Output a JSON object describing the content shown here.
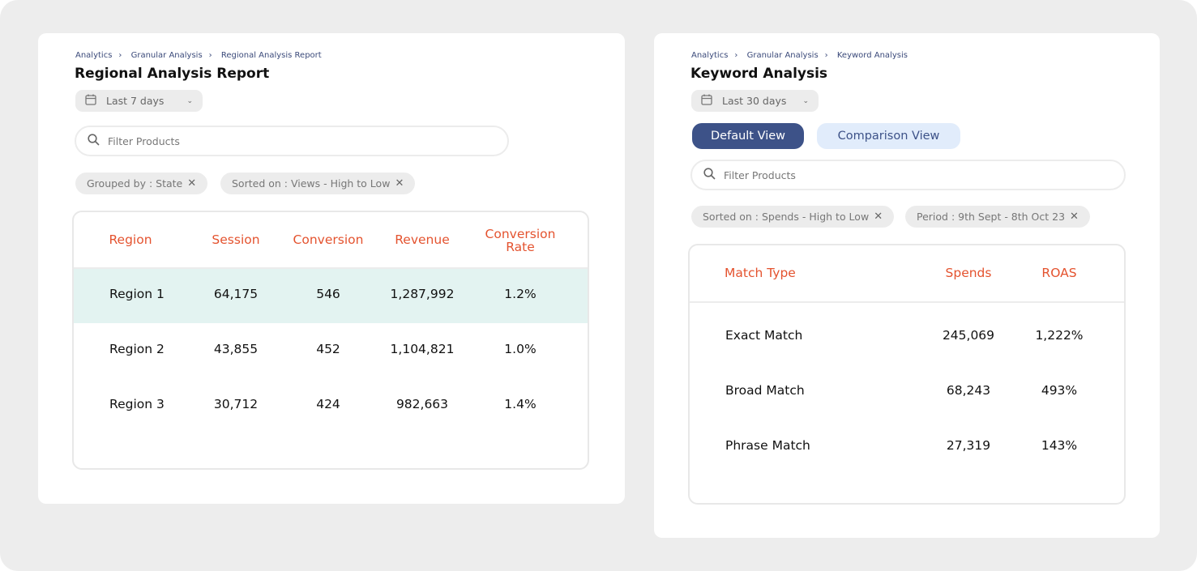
{
  "left": {
    "breadcrumb": [
      "Analytics",
      "Granular Analysis",
      "Regional Analysis Report"
    ],
    "title": "Regional Analysis Report",
    "date_range": "Last 7 days",
    "search_placeholder": "Filter Products",
    "chips": [
      "Grouped by : State",
      "Sorted on : Views - High to Low"
    ],
    "columns": [
      "Region",
      "Session",
      "Conversion",
      "Revenue",
      "Conversion Rate"
    ],
    "rows": [
      [
        "Region 1",
        "64,175",
        "546",
        "1,287,992",
        "1.2%"
      ],
      [
        "Region 2",
        "43,855",
        "452",
        "1,104,821",
        "1.0%"
      ],
      [
        "Region 3",
        "30,712",
        "424",
        "982,663",
        "1.4%"
      ]
    ],
    "highlight_color": "#e3f3f1"
  },
  "right": {
    "breadcrumb": [
      "Analytics",
      "Granular Analysis",
      "Keyword Analysis"
    ],
    "title": "Keyword Analysis",
    "date_range": "Last 30 days",
    "views": [
      "Default View",
      "Comparison View"
    ],
    "active_view": "Default View",
    "search_placeholder": "Filter Products",
    "chips": [
      "Sorted on : Spends - High to Low",
      "Period : 9th Sept - 8th Oct 23"
    ],
    "columns": [
      "Match Type",
      "Spends",
      "ROAS"
    ],
    "rows": [
      [
        "Exact Match",
        "245,069",
        "1,222%"
      ],
      [
        "Broad Match",
        "68,243",
        "493%"
      ],
      [
        "Phrase Match",
        "27,319",
        "143%"
      ]
    ]
  },
  "colors": {
    "accent": "#e4532f",
    "primary": "#3d5288",
    "secondary_bg": "#e1ecfb",
    "breadcrumb": "#3b4a7a"
  },
  "icons": {
    "separator": ">",
    "date": "calendar-icon",
    "search": "search-icon",
    "remove": "close-icon"
  }
}
